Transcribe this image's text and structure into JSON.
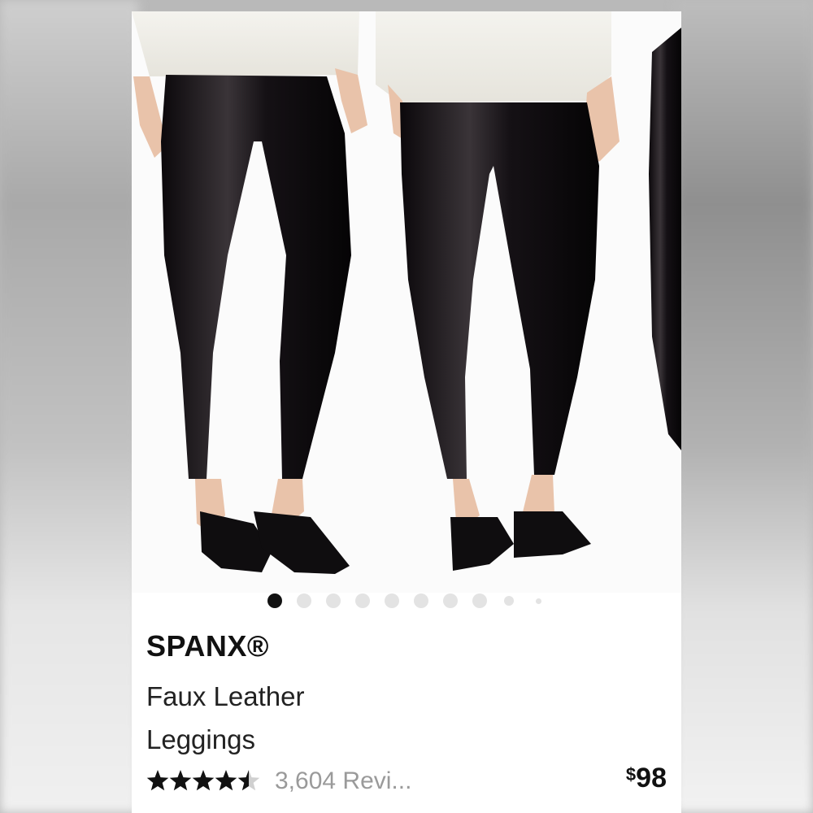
{
  "product": {
    "brand": "SPANX®",
    "title_line1": "Faux Leather",
    "title_line2": "Leggings",
    "rating": 4.5,
    "rating_max": 5,
    "reviews_text": "3,604 Revi...",
    "price_currency": "$",
    "price_value": "98"
  },
  "carousel": {
    "image_count": 10,
    "active_index": 0
  },
  "icons": [
    "star-icon",
    "half-star-icon"
  ],
  "colors": {
    "text_primary": "#111111",
    "text_secondary": "#9a9a9a",
    "dot_active": "#111111",
    "dot_inactive": "#e3e3e3",
    "leggings": "#141014"
  }
}
